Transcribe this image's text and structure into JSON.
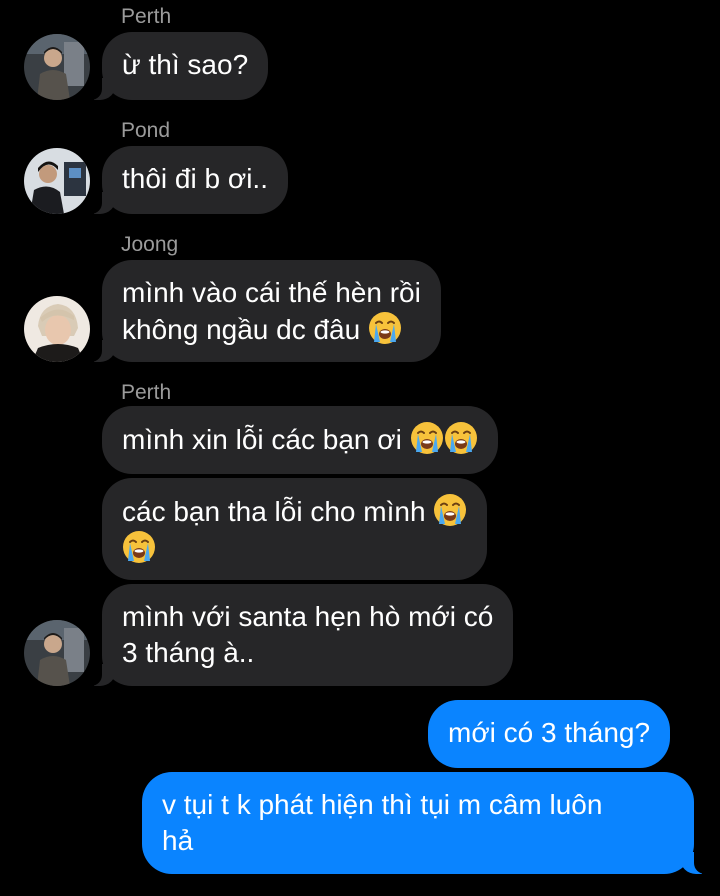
{
  "conversation": {
    "messages": [
      {
        "sender": "Perth",
        "lines": [
          "ừ thì sao?"
        ]
      },
      {
        "sender": "Pond",
        "lines": [
          "thôi đi b ơi.."
        ]
      },
      {
        "sender": "Joong",
        "lines": [
          "mình vào cái thế hèn rồi",
          "không ngầu dc đâu"
        ]
      },
      {
        "sender": "Perth",
        "lines": [
          "mình xin lỗi các bạn ơi"
        ]
      },
      {
        "sender": "Perth",
        "lines": [
          "các bạn tha lỗi cho mình"
        ]
      },
      {
        "sender": "Perth",
        "lines": [
          "mình với santa hẹn hò mới có",
          "3 tháng à.."
        ]
      },
      {
        "sender": "me",
        "lines": [
          "mới có 3 tháng?"
        ]
      },
      {
        "sender": "me",
        "lines": [
          "v tụi t k phát hiện thì tụi m câm luôn",
          "hả"
        ]
      }
    ],
    "emoji_name": "loudly-crying-face-icon"
  },
  "colors": {
    "background": "#000000",
    "incoming_bubble": "#262628",
    "outgoing_bubble": "#0a84ff",
    "sender_name": "#9b9b9b"
  }
}
